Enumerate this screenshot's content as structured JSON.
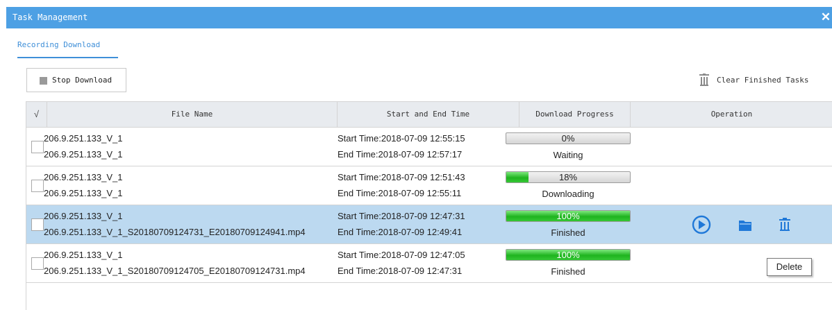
{
  "window": {
    "title": "Task Management",
    "close_icon": "close-icon",
    "accent": "#4da0e4"
  },
  "tabs": [
    {
      "label": "Recording Download",
      "active": true
    }
  ],
  "toolbar": {
    "stop_label": "Stop Download",
    "stop_icon": "stop-square-icon",
    "clear_label": "Clear Finished Tasks",
    "clear_icon": "trash-icon"
  },
  "table": {
    "check_header": "√",
    "headers": {
      "file": "File Name",
      "time": "Start and End Time",
      "progress": "Download Progress",
      "operation": "Operation"
    },
    "rows": [
      {
        "name_line1": "206.9.251.133_V_1",
        "name_line2": "206.9.251.133_V_1",
        "start": "Start Time:2018-07-09 12:55:15",
        "end": "End Time:2018-07-09 12:57:17",
        "progress": 0,
        "progress_label": "0%",
        "status": "Waiting",
        "selected": false,
        "operations": []
      },
      {
        "name_line1": "206.9.251.133_V_1",
        "name_line2": "206.9.251.133_V_1",
        "start": "Start Time:2018-07-09 12:51:43",
        "end": "End Time:2018-07-09 12:55:11",
        "progress": 18,
        "progress_label": "18%",
        "status": "Downloading",
        "selected": false,
        "operations": []
      },
      {
        "name_line1": "206.9.251.133_V_1",
        "name_line2": "206.9.251.133_V_1_S20180709124731_E20180709124941.mp4",
        "start": "Start Time:2018-07-09 12:47:31",
        "end": "End Time:2018-07-09 12:49:41",
        "progress": 100,
        "progress_label": "100%",
        "status": "Finished",
        "selected": true,
        "operations": [
          "play-icon",
          "folder-icon",
          "trash-icon"
        ]
      },
      {
        "name_line1": "206.9.251.133_V_1",
        "name_line2": "206.9.251.133_V_1_S20180709124705_E20180709124731.mp4",
        "start": "Start Time:2018-07-09 12:47:05",
        "end": "End Time:2018-07-09 12:47:31",
        "progress": 100,
        "progress_label": "100%",
        "status": "Finished",
        "selected": false,
        "operations": []
      }
    ]
  },
  "tooltip": {
    "text": "Delete"
  }
}
